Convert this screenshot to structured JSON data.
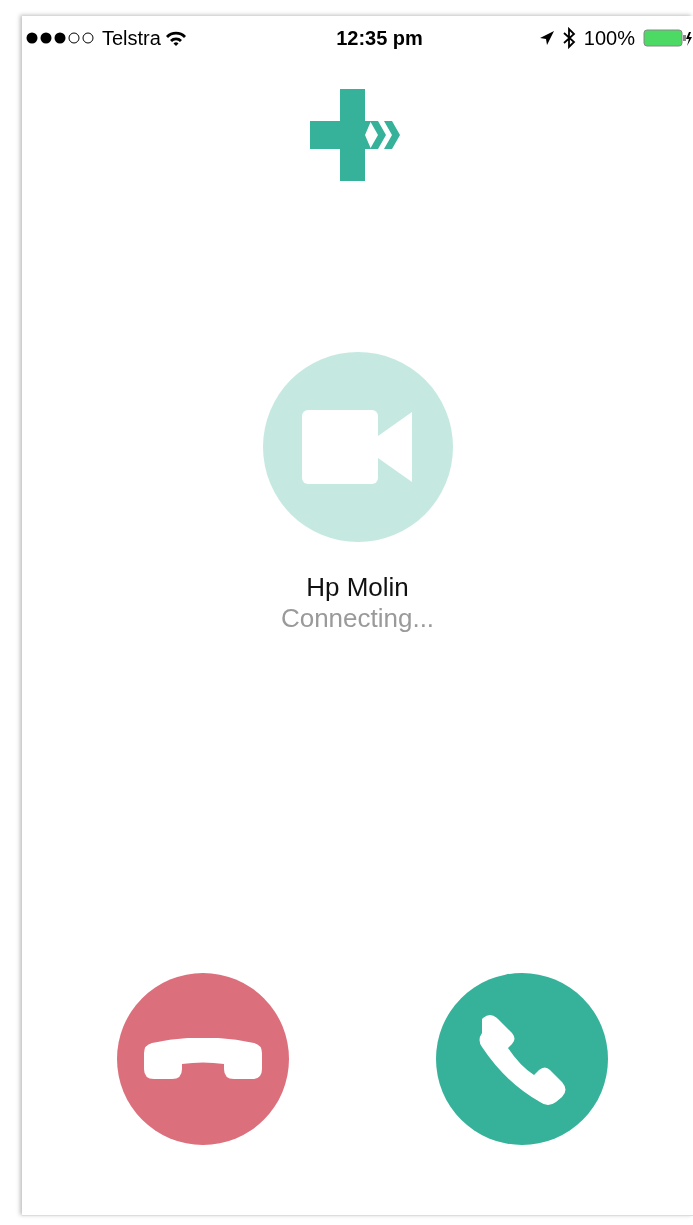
{
  "status_bar": {
    "carrier": "Telstra",
    "time": "12:35 pm",
    "battery": "100%"
  },
  "call": {
    "name": "Hp Molin",
    "status": "Connecting..."
  },
  "actions": [
    {
      "kind": "decline",
      "color": "#dc6f7c"
    },
    {
      "kind": "accept",
      "color": "#36b19a"
    }
  ]
}
